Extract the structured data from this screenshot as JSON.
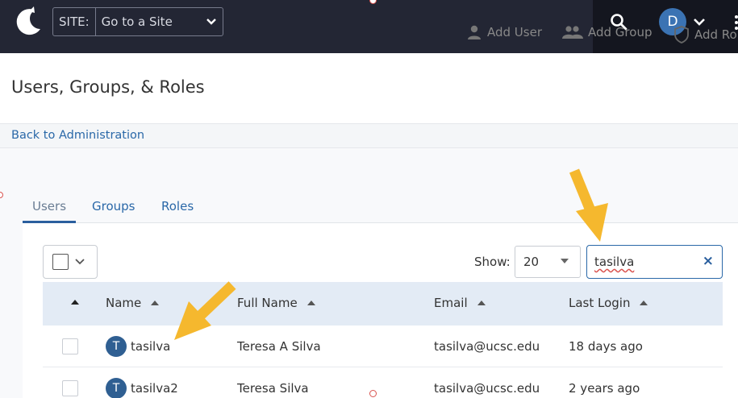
{
  "topbar": {
    "site_label": "SITE:",
    "site_placeholder": "Go to a Site",
    "avatar_initial": "D"
  },
  "header": {
    "title": "Users, Groups, & Roles",
    "actions": {
      "add_user": "Add User",
      "add_group": "Add Group",
      "add_role": "Add Ro"
    }
  },
  "back_link": "Back to Administration",
  "tabs": {
    "users": "Users",
    "groups": "Groups",
    "roles": "Roles"
  },
  "toolbar": {
    "show_label": "Show:",
    "page_size": "20",
    "search_value": "tasilva",
    "clear_symbol": "×"
  },
  "table": {
    "columns": {
      "name": "Name",
      "full_name": "Full Name",
      "email": "Email",
      "last_login": "Last Login"
    },
    "rows": [
      {
        "initial": "T",
        "username": "tasilva",
        "full_name": "Teresa A Silva",
        "email": "tasilva@ucsc.edu",
        "last_login": "18 days ago"
      },
      {
        "initial": "T",
        "username": "tasilva2",
        "full_name": "Teresa Silva",
        "email": "tasilva@ucsc.edu",
        "last_login": "2 years ago"
      }
    ]
  },
  "colors": {
    "topbar": "#232634",
    "link": "#2a68a8",
    "annotation_arrow": "#f5b82e",
    "avatar": "#2f5f92"
  }
}
